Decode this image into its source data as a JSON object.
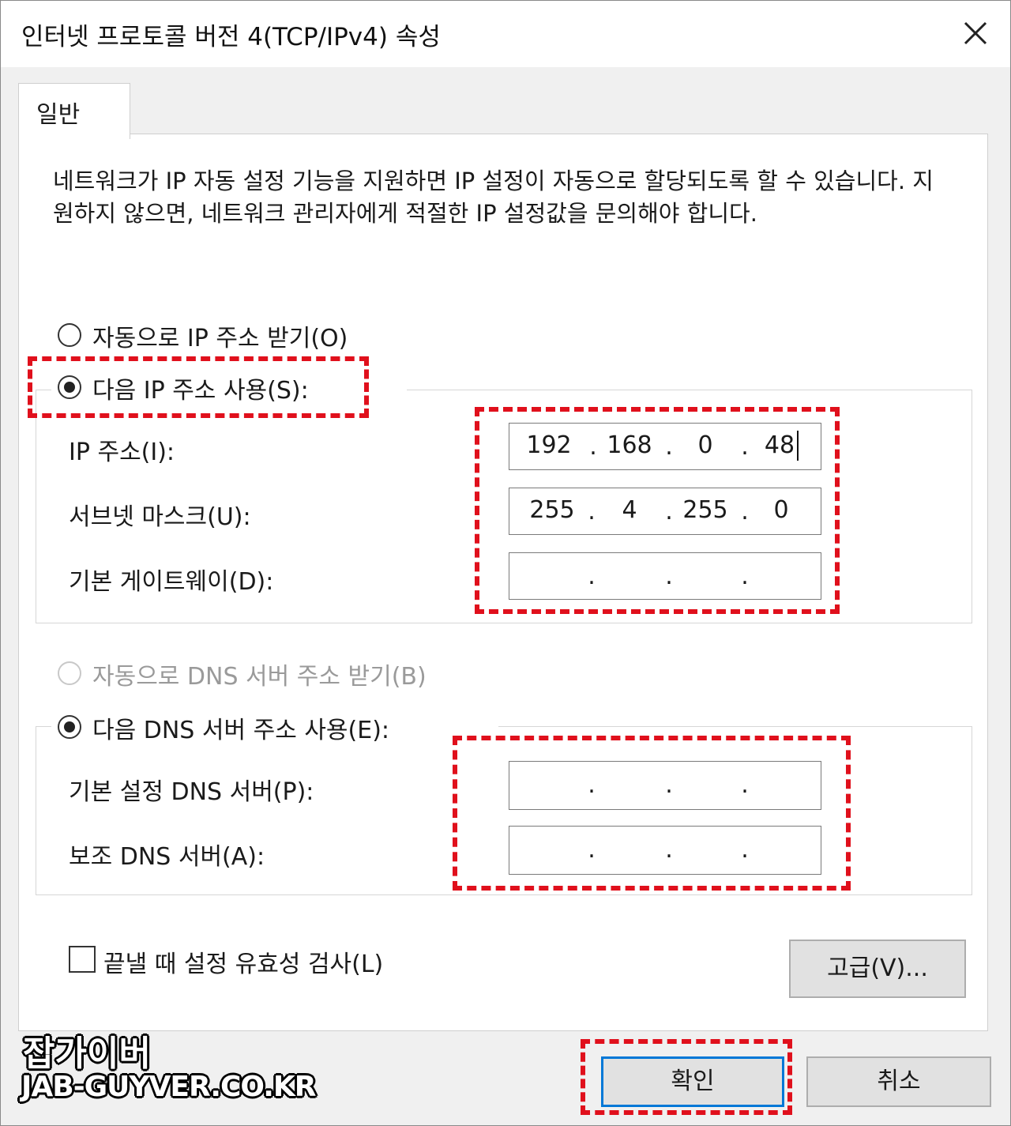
{
  "window": {
    "title": "인터넷 프로토콜 버전 4(TCP/IPv4) 속성",
    "close_glyph": "✕"
  },
  "tab": {
    "label": "일반"
  },
  "description": "네트워크가 IP 자동 설정 기능을 지원하면 IP 설정이 자동으로 할당되도록 할 수 있습니다. 지원하지 않으면, 네트워크 관리자에게 적절한 IP 설정값을 문의해야 합니다.",
  "ip_section": {
    "auto_label": "자동으로 IP 주소 받기(O)",
    "manual_label": "다음 IP 주소 사용(S):",
    "selected": "manual",
    "ip_address": {
      "label": "IP 주소(I):",
      "octets": [
        "192",
        "168",
        "0",
        "48"
      ]
    },
    "subnet_mask": {
      "label": "서브넷 마스크(U):",
      "octets": [
        "255",
        "4",
        "255",
        "0"
      ]
    },
    "gateway": {
      "label": "기본 게이트웨이(D):",
      "octets": [
        "",
        "",
        "",
        ""
      ]
    }
  },
  "dns_section": {
    "auto_label": "자동으로 DNS 서버 주소 받기(B)",
    "manual_label": "다음 DNS 서버 주소 사용(E):",
    "selected": "manual",
    "auto_disabled": true,
    "preferred": {
      "label": "기본 설정 DNS 서버(P):",
      "octets": [
        "",
        "",
        "",
        ""
      ]
    },
    "alternate": {
      "label": "보조 DNS 서버(A):",
      "octets": [
        "",
        "",
        "",
        ""
      ]
    }
  },
  "validate_checkbox": {
    "label": "끝낼 때 설정 유효성 검사(L)",
    "checked": false
  },
  "buttons": {
    "advanced": "고급(V)...",
    "ok": "확인",
    "cancel": "취소"
  },
  "watermark": {
    "line1": "잡가이버",
    "line2": "JAB-GUYVER.CO.KR"
  },
  "colors": {
    "highlight": "#e0101c",
    "default_button_border": "#0078d7"
  }
}
